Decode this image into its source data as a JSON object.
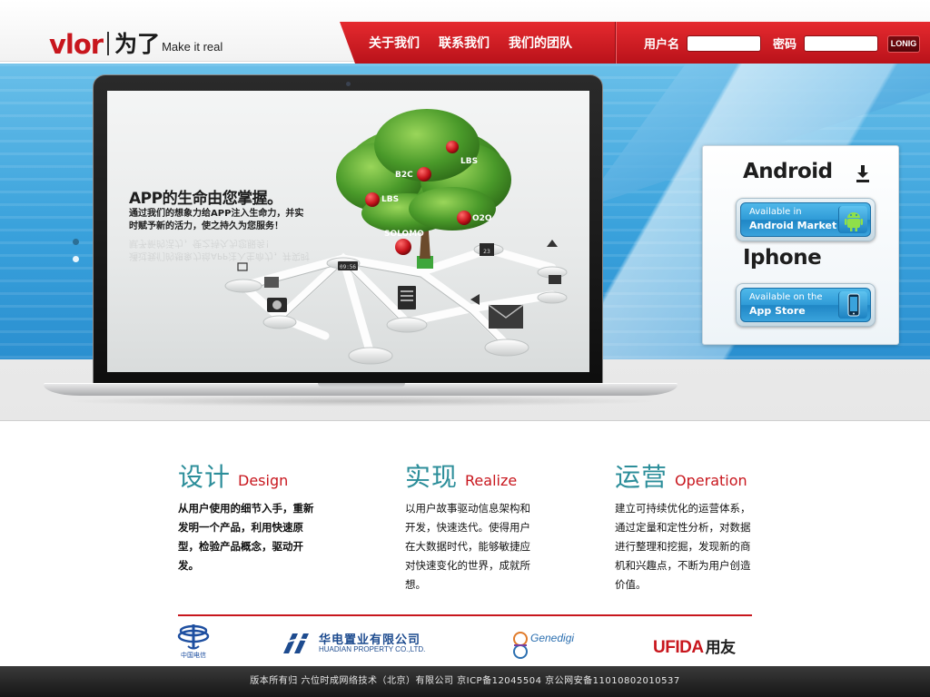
{
  "logo": {
    "brand": "vlor",
    "cn": "为了",
    "tagline": "Make it real"
  },
  "nav": {
    "items": [
      "关于我们",
      "联系我们",
      "我们的团队"
    ]
  },
  "login": {
    "username_label": "用户名",
    "password_label": "密码",
    "username_value": "",
    "password_value": "",
    "button_label": "LONIG"
  },
  "banner": {
    "slider_dots": 2,
    "active_dot": 1,
    "screen_title": "APP的生命由您掌握。",
    "screen_subtitle": "通过我们的想象力给APP注入生命力，并实时赋予新的活力，使之持久为您服务！",
    "tree_labels": [
      "B2C",
      "LBS",
      "LBS",
      "O2O",
      "SOLOMO"
    ],
    "clock": "09:56",
    "calendar": "23"
  },
  "downloads": {
    "android_title": "Android",
    "android_btn_line1": "Available in",
    "android_btn_line2": "Android Market",
    "iphone_title": "Iphone",
    "iphone_btn_line1": "Available on the",
    "iphone_btn_line2": "App Store"
  },
  "features": [
    {
      "cn": "设计",
      "en": "Design",
      "text": "从用户使用的细节入手，重新发明一个产品，利用快速原型，检验产品概念，驱动开发。"
    },
    {
      "cn": "实现",
      "en": "Realize",
      "text": "以用户故事驱动信息架构和开发，快速迭代。使得用户在大数据时代，能够敏捷应对快速变化的世界，成就所想。"
    },
    {
      "cn": "运营",
      "en": "Operation",
      "text": "建立可持续优化的运营体系，通过定量和定性分析，对数据进行整理和挖掘，发现新的商机和兴趣点，不断为用户创造价值。"
    }
  ],
  "partners": {
    "telecom": "中国电信",
    "huadian_cn": "华电置业有限公司",
    "huadian_en": "HUADIAN PROPERTY CO.,LTD.",
    "genedigi": "Genedigi",
    "ufida": "UFIDA",
    "ufida_cn": "用友"
  },
  "footer": {
    "text": "版本所有归 六位时成网络技术（北京）有限公司  京ICP备12045504 京公网安备11010802010537"
  },
  "colors": {
    "brand_red": "#c8161d",
    "teal": "#2c8e9a",
    "banner_blue": "#3aa2dc"
  }
}
